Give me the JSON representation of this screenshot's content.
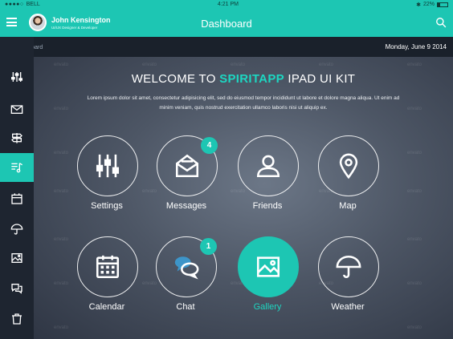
{
  "status_bar": {
    "carrier": "BELL",
    "time": "4:21 PM",
    "battery": "22%"
  },
  "header": {
    "user_name": "John Kensington",
    "user_role": "UI/UX Designer & Developer",
    "title": "Dashboard"
  },
  "breadcrumb": {
    "label": "Dashboard"
  },
  "date": "Monday, June 9 2014",
  "welcome": {
    "prefix": "WELCOME TO ",
    "accent": "SPIRITAPP",
    "suffix": " IPAD UI KIT",
    "body": "Lorem ipsum dolor sit amet, consectetur adipisicing elit, sed do eiusmod tempor incididunt ut labore et dolore magna aliqua. Ut enim ad minim veniam, quis nostrud exercitation ullamco laboris nisi ut aliquip ex."
  },
  "tiles": [
    {
      "label": "Settings",
      "icon": "sliders-icon"
    },
    {
      "label": "Messages",
      "icon": "envelope-icon",
      "badge": "4"
    },
    {
      "label": "Friends",
      "icon": "user-icon"
    },
    {
      "label": "Map",
      "icon": "map-pin-icon"
    },
    {
      "label": "Calendar",
      "icon": "calendar-icon"
    },
    {
      "label": "Chat",
      "icon": "chat-bubbles-icon",
      "badge": "1"
    },
    {
      "label": "Gallery",
      "icon": "image-icon",
      "active": true
    },
    {
      "label": "Weather",
      "icon": "umbrella-icon"
    }
  ],
  "sidebar": [
    "sliders-icon",
    "envelope-icon",
    "signpost-icon",
    "music-list-icon",
    "calendar-icon",
    "umbrella-icon",
    "image-icon",
    "chat-bubbles-icon",
    "trash-icon"
  ],
  "watermark_text": "envato",
  "colors": {
    "accent": "#1dc6b3",
    "sidebar": "#1e2530",
    "crumbbar": "#1a212b"
  }
}
